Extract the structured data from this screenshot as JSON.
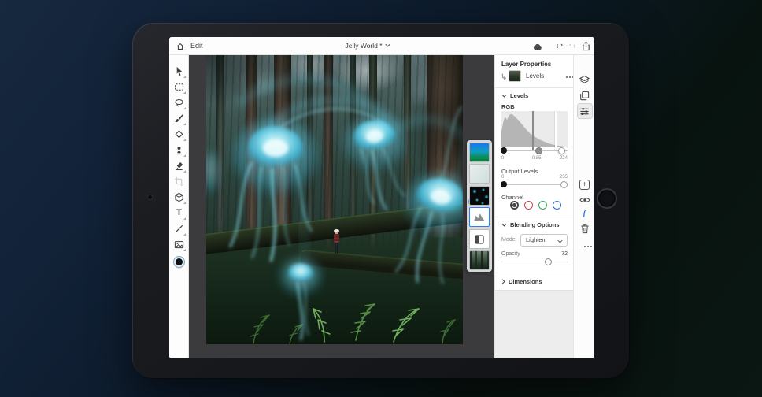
{
  "app": {
    "edit_menu": "Edit",
    "title": "Jelly World *"
  },
  "icons": {
    "undo": "↩",
    "redo": "↪",
    "type_tool": "T",
    "fx": "ƒ",
    "fx_badge": "ƒ",
    "clip_badge": "ƒ",
    "plus": "+"
  },
  "toolbar": {
    "tools": [
      "move",
      "marquee-select",
      "lasso-select",
      "brush",
      "fill",
      "clone-stamp",
      "eraser",
      "crop",
      "shapes",
      "type",
      "line",
      "place-image"
    ],
    "foreground_color": "#0d1013"
  },
  "layers_strip": {
    "thumbnails": [
      "gradient-fill",
      "solid-light",
      "jellyfish-cutout",
      "levels-adjustment",
      "mask-adjustment",
      "forest-photo"
    ],
    "selected": "levels-adjustment"
  },
  "panel": {
    "header": "Layer Properties",
    "layer": {
      "name": "Levels"
    },
    "levels": {
      "title": "Levels",
      "channel": "RGB",
      "input_black": "0",
      "input_gamma": "0.85",
      "input_white": "224",
      "output_label": "Output Levels",
      "output_min": "0",
      "output_max": "255",
      "channel_label": "Channel"
    },
    "blending": {
      "title": "Blending Options",
      "mode_label": "Mode",
      "mode_value": "Lighten",
      "opacity_label": "Opacity",
      "opacity_value": "72"
    },
    "dimensions": {
      "title": "Dimensions"
    }
  },
  "colors": {
    "accent_blue": "#2a7fff",
    "channel_red": "#d23f3f",
    "channel_green": "#3aa356",
    "channel_blue": "#2f6fd0",
    "jellyfish_cyan": "#58e6ff"
  }
}
